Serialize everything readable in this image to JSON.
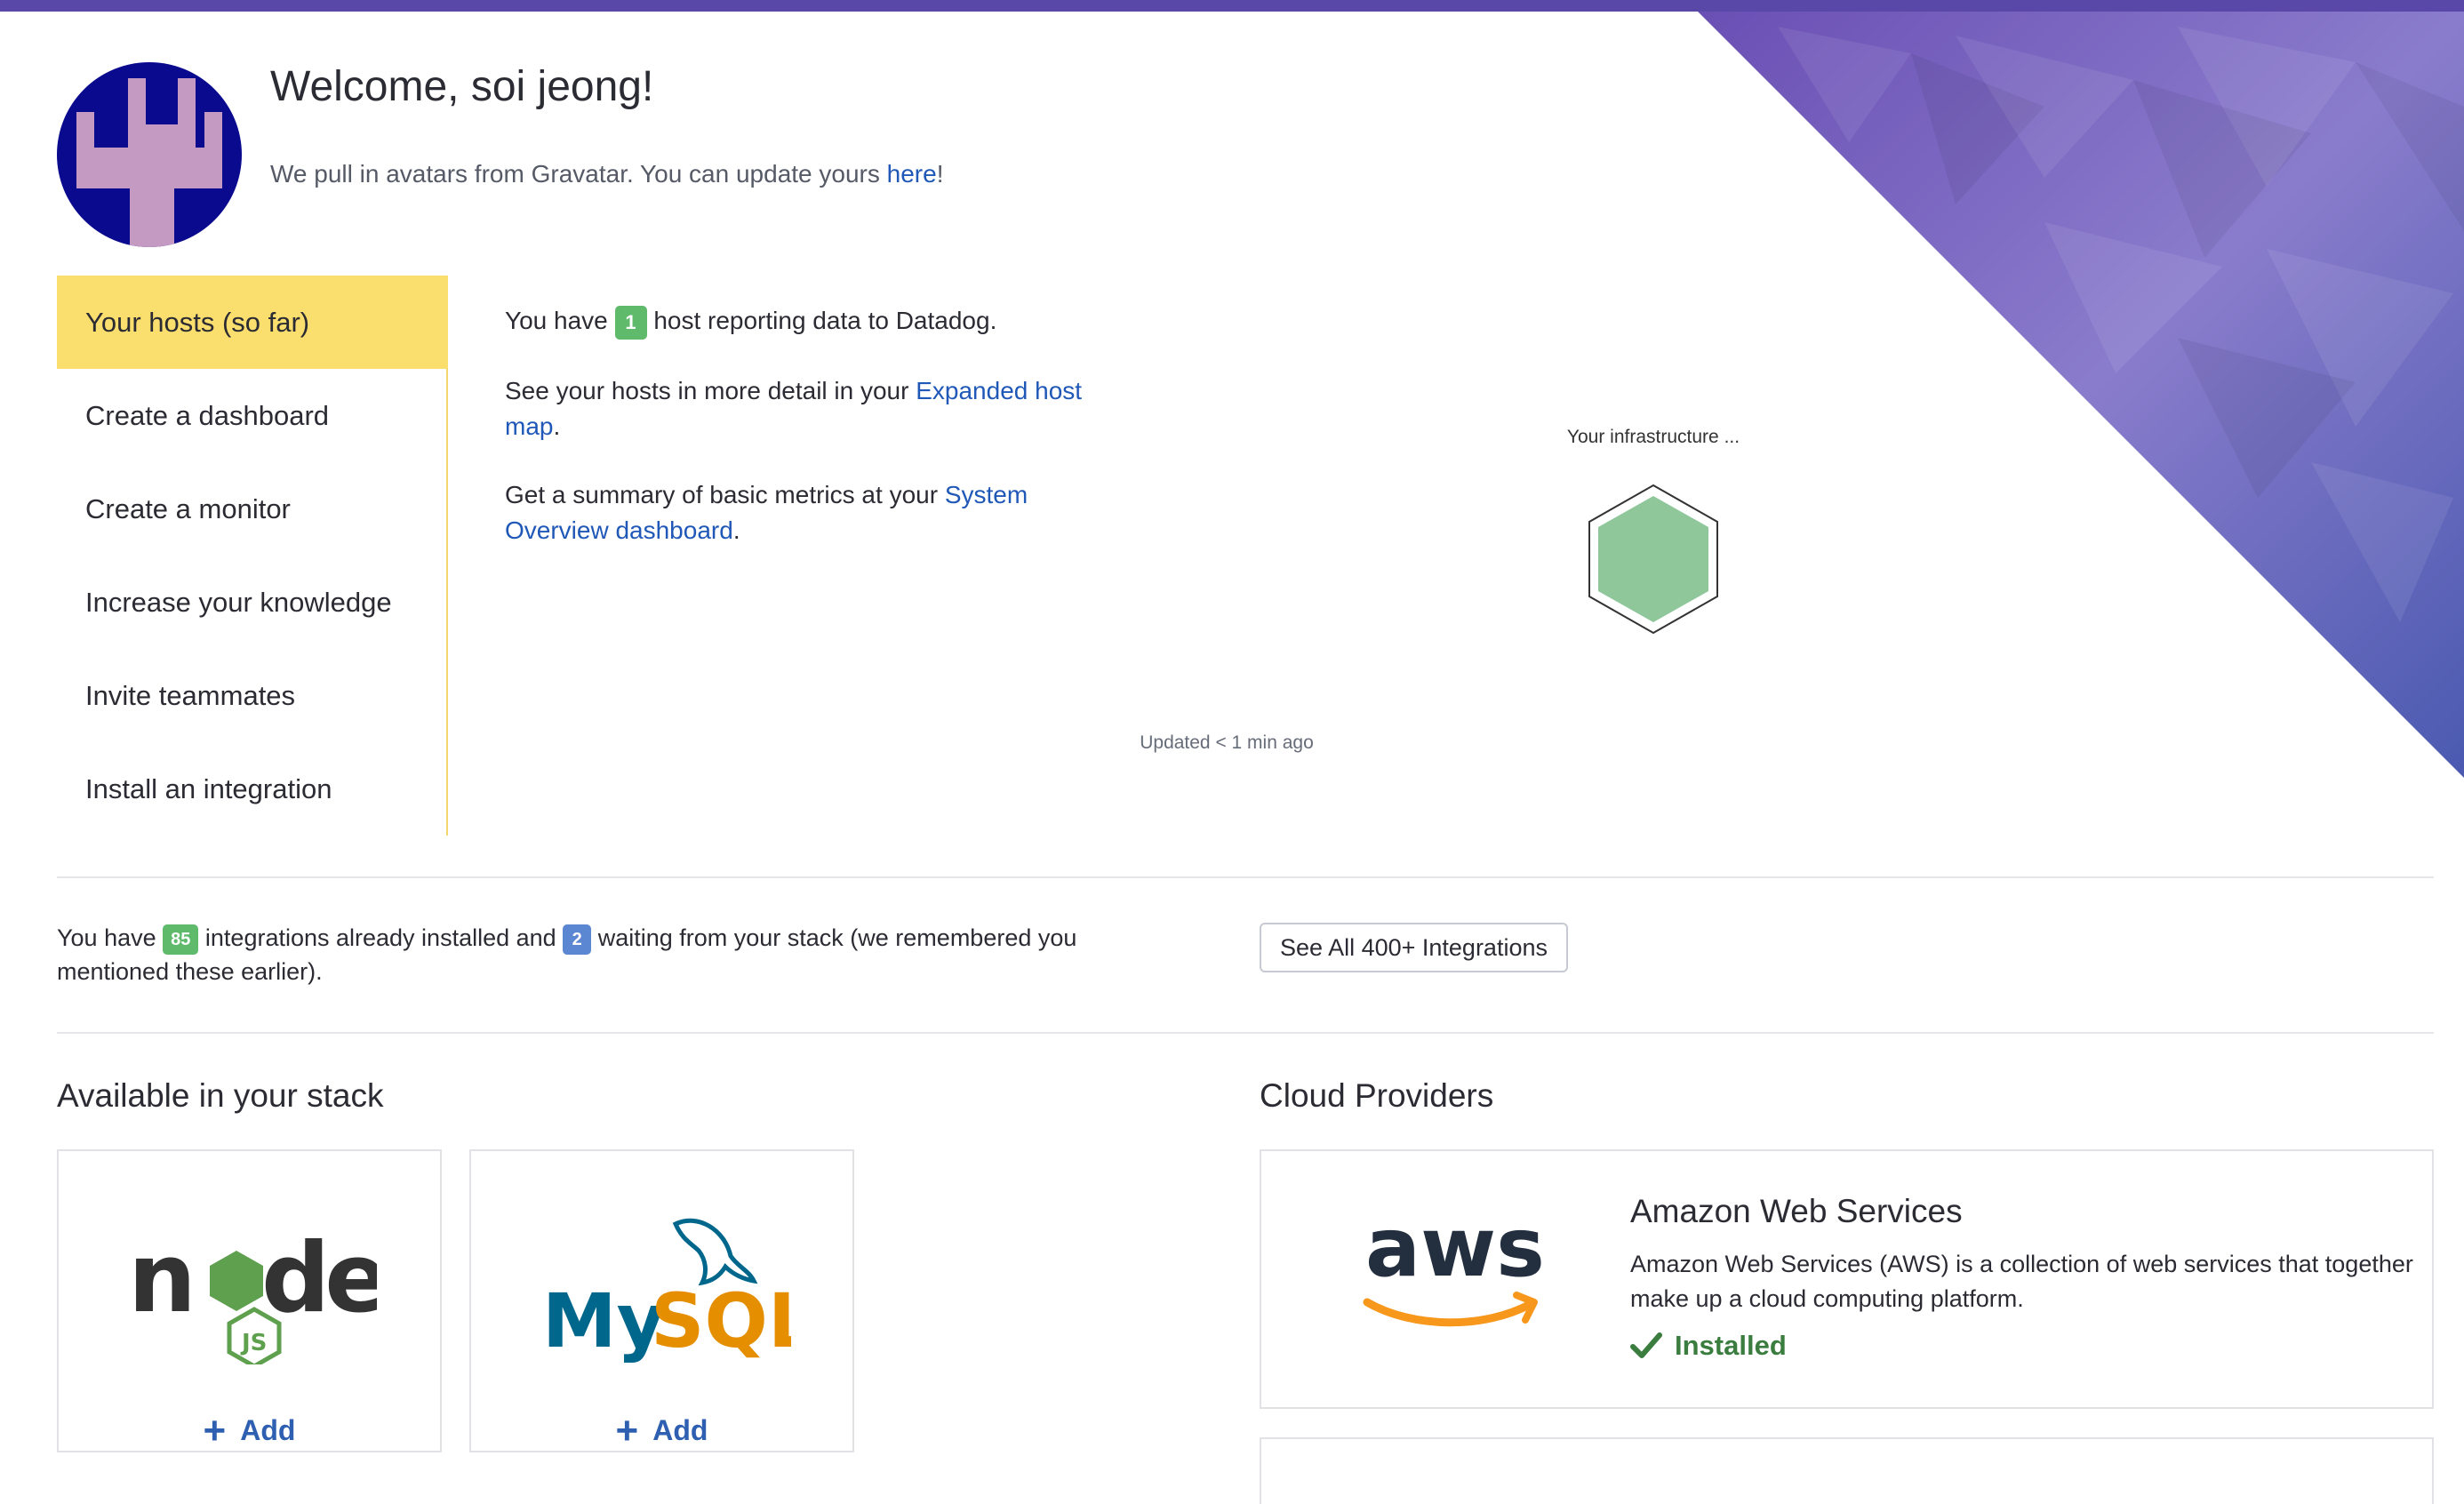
{
  "welcome": {
    "title": "Welcome, soi jeong!",
    "subtitle_prefix": "We pull in avatars from Gravatar. You can update yours ",
    "subtitle_link": "here",
    "subtitle_suffix": "!"
  },
  "tabs": [
    {
      "label": "Your hosts (so far)",
      "active": true
    },
    {
      "label": "Create a dashboard",
      "active": false
    },
    {
      "label": "Create a monitor",
      "active": false
    },
    {
      "label": "Increase your knowledge",
      "active": false
    },
    {
      "label": "Invite teammates",
      "active": false
    },
    {
      "label": "Install an integration",
      "active": false
    }
  ],
  "hosts": {
    "line1_prefix": "You have",
    "host_count": "1",
    "line1_suffix": "host reporting data to Datadog.",
    "line2_prefix": "See your hosts in more detail in your ",
    "line2_link": "Expanded host map",
    "line2_suffix": ".",
    "line3_prefix": "Get a summary of basic metrics at your ",
    "line3_link": "System Overview dashboard",
    "line3_suffix": ".",
    "infra_label": "Your infrastructure ...",
    "updated": "Updated < 1 min ago"
  },
  "integrations": {
    "prefix": "You have",
    "installed_count": "85",
    "middle": "integrations already installed and",
    "waiting_count": "2",
    "suffix": "waiting from your stack (we remembered you mentioned these earlier).",
    "see_all_label": "See All 400+ Integrations"
  },
  "stack": {
    "title": "Available in your stack",
    "cards": [
      {
        "name": "node",
        "add_label": "Add"
      },
      {
        "name": "MySQL",
        "add_label": "Add"
      }
    ]
  },
  "cloud": {
    "title": "Cloud Providers",
    "aws": {
      "logo_text": "aws",
      "title": "Amazon Web Services",
      "description": "Amazon Web Services (AWS) is a collection of web services that together make up a cloud computing platform.",
      "status": "Installed"
    }
  },
  "colors": {
    "accent_purple": "#5a48a8",
    "active_tab": "#fade6e",
    "link": "#2058b8",
    "badge_green": "#5fba6c",
    "badge_blue": "#5b86d1",
    "installed_green": "#3a7d3f",
    "hex_fill": "#8fc79b"
  }
}
